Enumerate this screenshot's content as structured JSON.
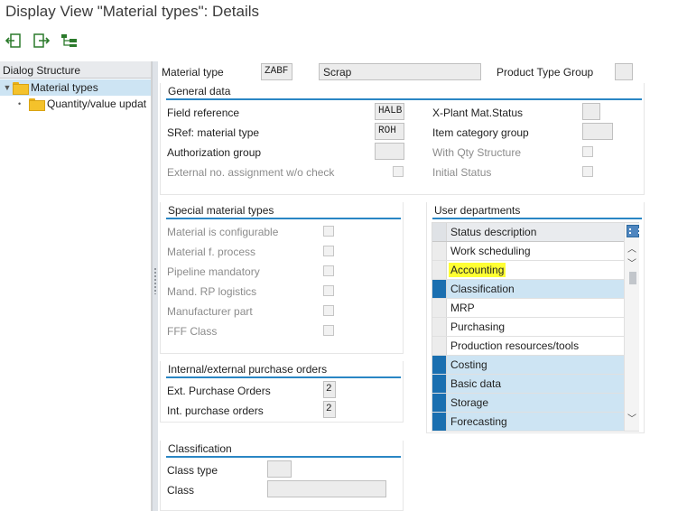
{
  "window": {
    "title": "Display View \"Material types\": Details"
  },
  "toolbar": {
    "buttons": [
      {
        "icon": "back-arrow-icon"
      },
      {
        "icon": "forward-arrow-icon"
      },
      {
        "icon": "hierarchy-select-icon"
      }
    ]
  },
  "dialog_structure": {
    "header": "Dialog Structure",
    "items": [
      {
        "label": "Material types",
        "expanded": true,
        "selected": true
      },
      {
        "label": "Quantity/value updat",
        "selected": false
      }
    ]
  },
  "header_fields": {
    "material_type_label": "Material type",
    "material_type_value": "ZABF",
    "material_type_desc": "Scrap",
    "product_type_group_label": "Product Type Group",
    "product_type_group_value": ""
  },
  "general_data": {
    "title": "General data",
    "field_reference_label": "Field reference",
    "field_reference_value": "HALB",
    "sref_label": "SRef: material type",
    "sref_value": "ROH",
    "auth_group_label": "Authorization group",
    "auth_group_value": "",
    "ext_no_label": "External no. assignment w/o check",
    "xplant_label": "X-Plant Mat.Status",
    "xplant_value": "",
    "item_cat_label": "Item category group",
    "item_cat_value": "",
    "qty_struct_label": "With Qty Structure",
    "initial_status_label": "Initial Status"
  },
  "special_material_types": {
    "title": "Special material types",
    "items": [
      {
        "label": "Material is configurable",
        "checked": false
      },
      {
        "label": "Material f. process",
        "checked": false
      },
      {
        "label": "Pipeline mandatory",
        "checked": false
      },
      {
        "label": "Mand. RP logistics",
        "checked": false
      },
      {
        "label": "Manufacturer part",
        "checked": false
      },
      {
        "label": "FFF Class",
        "checked": false
      }
    ]
  },
  "purchase_orders": {
    "title": "Internal/external purchase orders",
    "ext_label": "Ext. Purchase Orders",
    "ext_value": "2",
    "int_label": "Int. purchase orders",
    "int_value": "2"
  },
  "classification": {
    "title": "Classification",
    "class_type_label": "Class type",
    "class_type_value": "",
    "class_label": "Class",
    "class_value": ""
  },
  "user_departments": {
    "title": "User departments",
    "column_header": "Status description",
    "rows": [
      {
        "label": "Work scheduling",
        "selected": false,
        "highlighted": false
      },
      {
        "label": "Accounting",
        "selected": false,
        "highlighted": true
      },
      {
        "label": "Classification",
        "selected": true,
        "highlighted": false
      },
      {
        "label": "MRP",
        "selected": false,
        "highlighted": false
      },
      {
        "label": "Purchasing",
        "selected": false,
        "highlighted": false
      },
      {
        "label": "Production resources/tools",
        "selected": false,
        "highlighted": false
      },
      {
        "label": "Costing",
        "selected": true,
        "highlighted": false
      },
      {
        "label": "Basic data",
        "selected": true,
        "highlighted": false
      },
      {
        "label": "Storage",
        "selected": true,
        "highlighted": false
      },
      {
        "label": "Forecasting",
        "selected": true,
        "highlighted": false
      }
    ]
  },
  "colors": {
    "accent_line": "#2a86c4",
    "row_selected": "#cde4f3",
    "row_marker": "#1a6fb0",
    "highlight": "#ffff33"
  }
}
